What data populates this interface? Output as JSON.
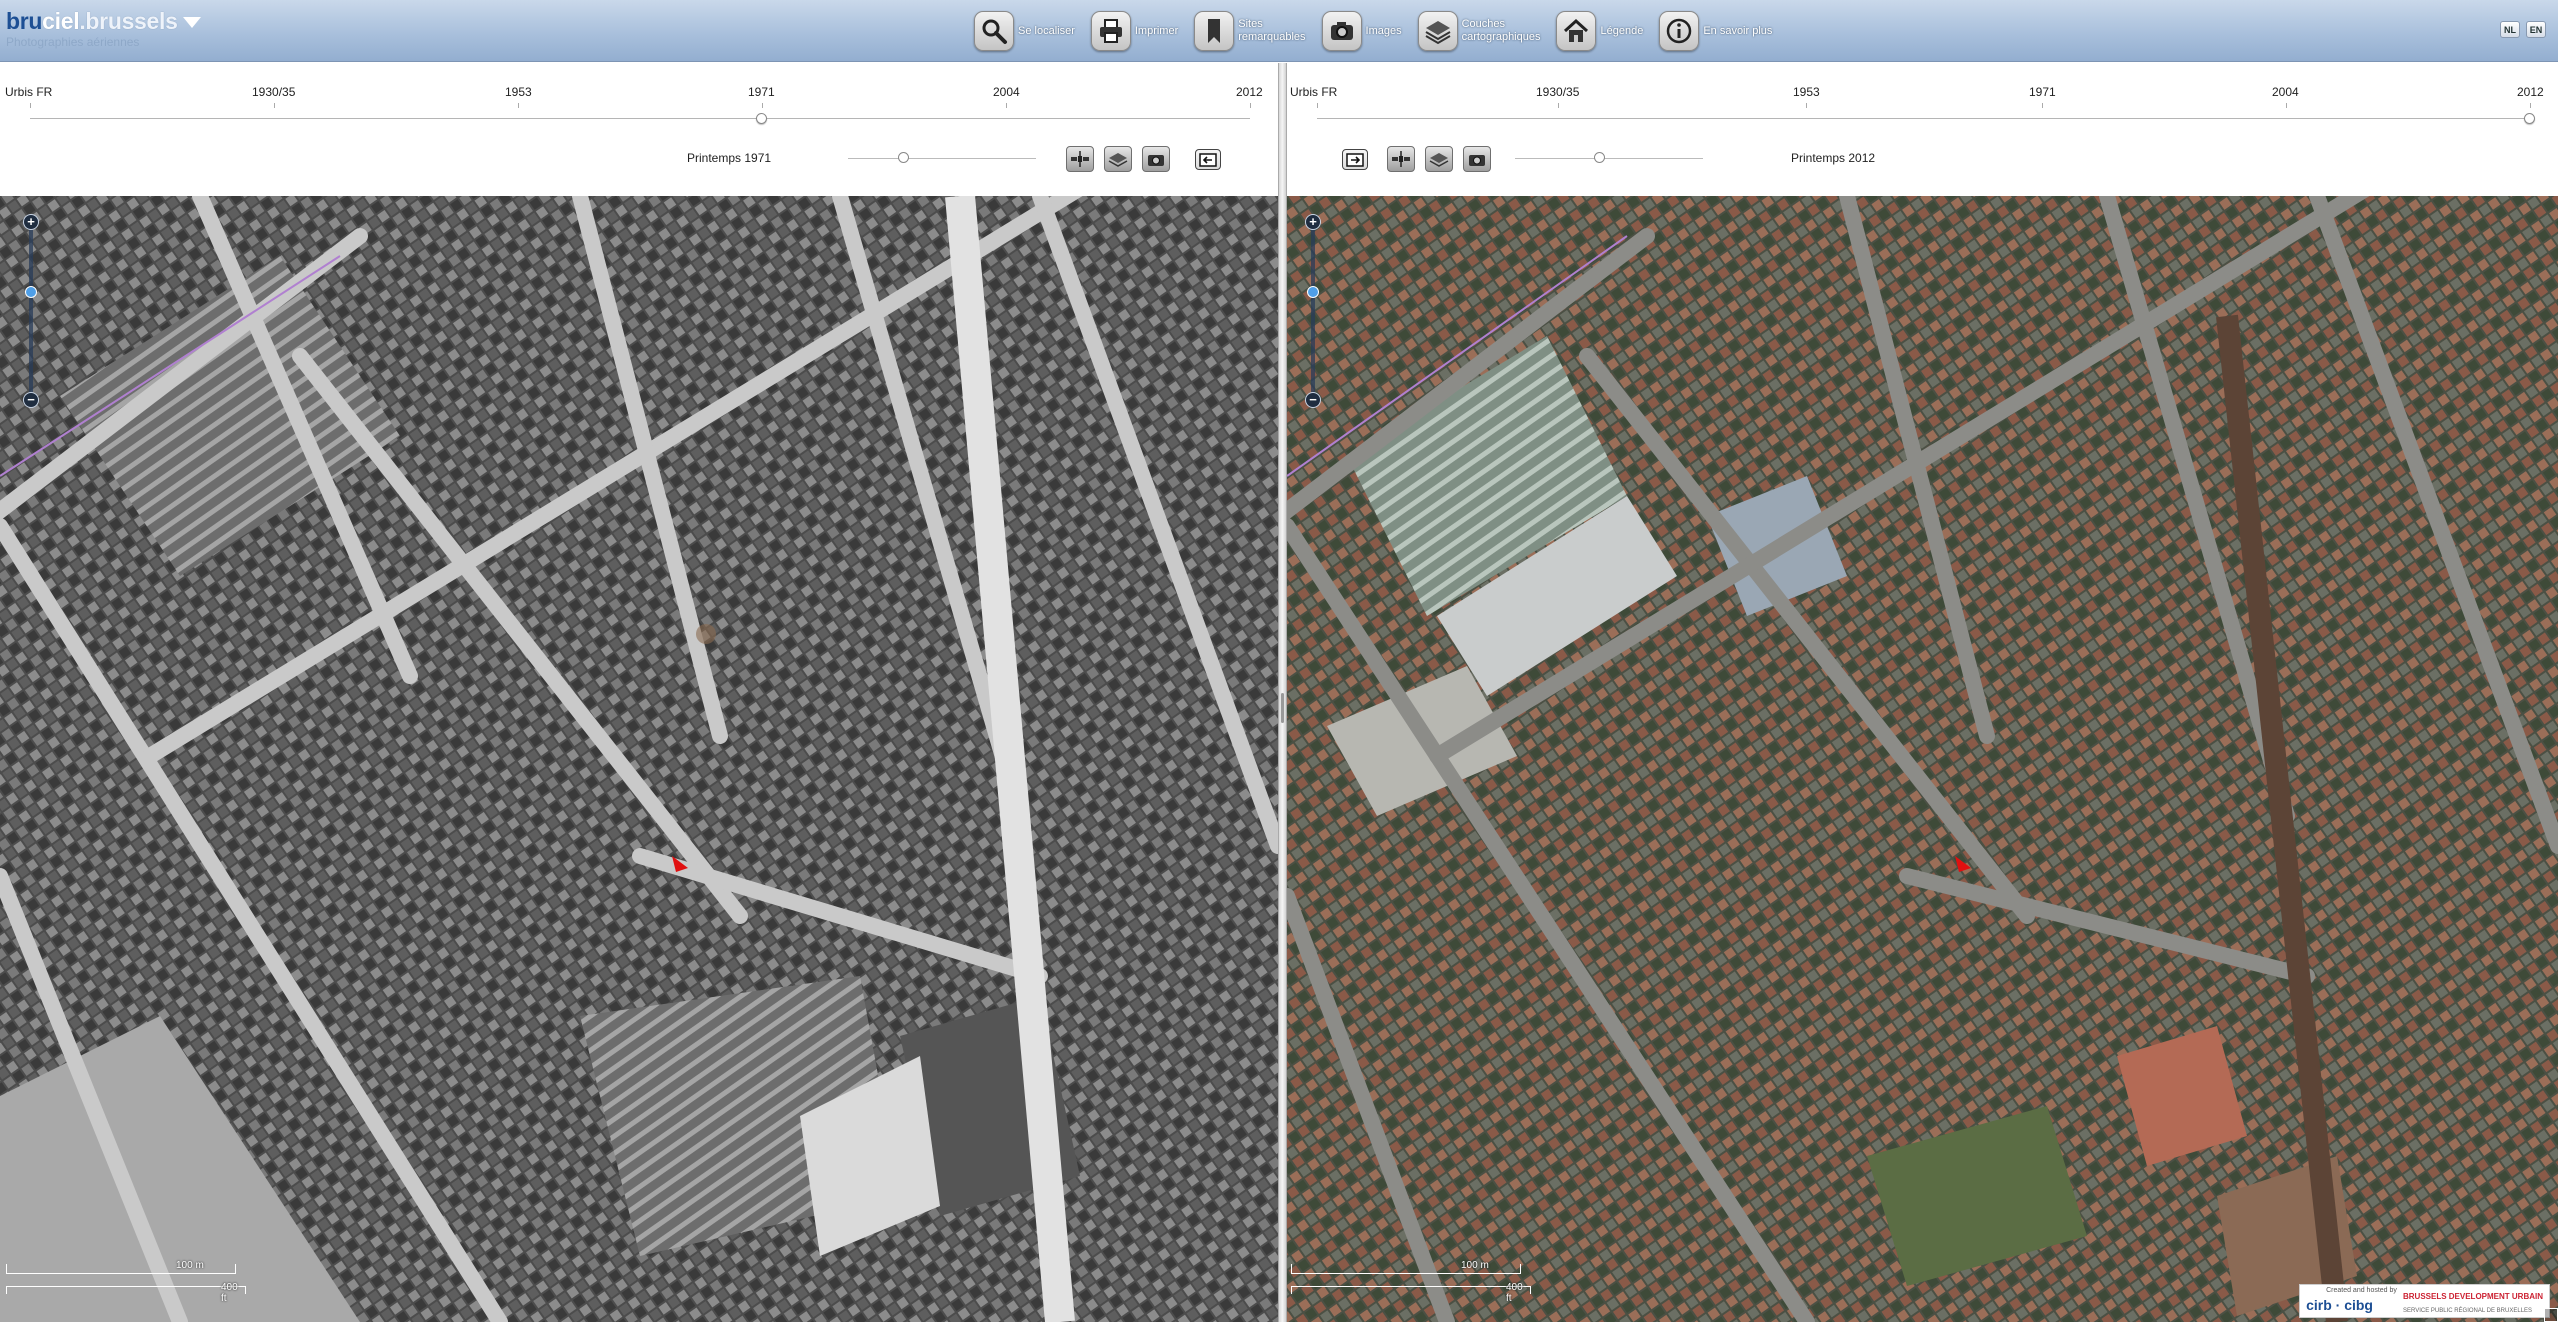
{
  "app": {
    "logo_part1": "bru",
    "logo_part2": "ciel",
    "logo_part3": ".brussels",
    "logo_subtitle": "Photographies aériennes"
  },
  "toolbar": [
    {
      "name": "locate",
      "label": "Se localiser",
      "icon": "magnifier-icon"
    },
    {
      "name": "print",
      "label": "Imprimer",
      "icon": "printer-icon"
    },
    {
      "name": "sites",
      "label": "Sites\nremarquables",
      "icon": "bookmark-icon"
    },
    {
      "name": "images",
      "label": "Images",
      "icon": "camera-icon"
    },
    {
      "name": "layers",
      "label": "Couches\ncartographiques",
      "icon": "layers-icon"
    },
    {
      "name": "legend",
      "label": "Légende",
      "icon": "house-icon"
    },
    {
      "name": "about",
      "label": "En savoir plus",
      "icon": "info-icon"
    }
  ],
  "languages": [
    "NL",
    "EN"
  ],
  "left_panel": {
    "timeline": [
      "Urbis FR",
      "1930/35",
      "1953",
      "1971",
      "2004",
      "2012"
    ],
    "selected_index": 3,
    "season": "Printemps 1971",
    "opacity_level": 0.3,
    "scale_m": "100 m",
    "scale_ft": "400 ft"
  },
  "right_panel": {
    "timeline": [
      "Urbis FR",
      "1930/35",
      "1953",
      "1971",
      "2004",
      "2012"
    ],
    "selected_index": 5,
    "season": "Printemps 2012",
    "opacity_level": 0.45,
    "scale_m": "100 m",
    "scale_ft": "400 ft"
  },
  "credits": {
    "small": "Created and hosted by",
    "cirb": "cirb · cibg",
    "bdu_line1": "BRUSSELS DEVELOPMENT URBAIN",
    "bdu_line2": "SERVICE PUBLIC RÉGIONAL DE BRUXELLES"
  },
  "colors": {
    "header_top": "#c9d8ea",
    "header_bottom": "#93aed0",
    "marker": "#e01010",
    "bw_map_bg": "#5e5e5e",
    "color_map_bg": "#4a4d46"
  }
}
